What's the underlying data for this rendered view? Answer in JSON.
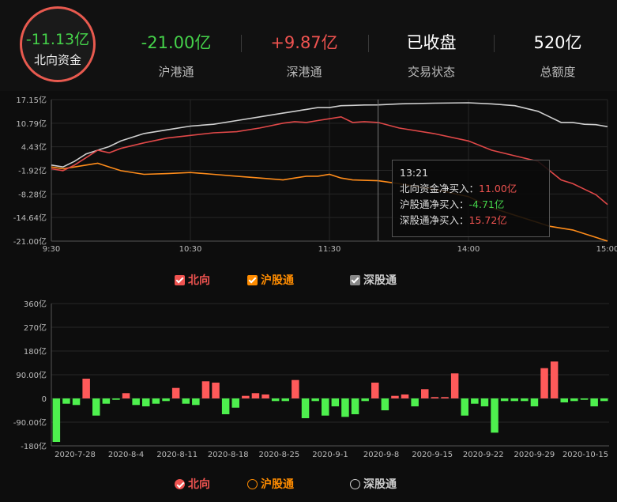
{
  "header": {
    "northbound_value": "-11.13亿",
    "northbound_label": "北向资金",
    "stats": [
      {
        "value": "-21.00亿",
        "label": "沪港通",
        "color": "#45d24a"
      },
      {
        "value": "+9.87亿",
        "label": "深港通",
        "color": "#ef5350"
      },
      {
        "value": "已收盘",
        "label": "交易状态",
        "color": "#ffffff"
      },
      {
        "value": "520亿",
        "label": "总额度",
        "color": "#ffffff"
      }
    ]
  },
  "intraday": {
    "tooltip": {
      "time": "13:21",
      "rows": [
        {
          "label": "北向资金净买入：",
          "value": "11.00亿",
          "color": "#ef5350"
        },
        {
          "label": "沪股通净买入：",
          "value": "-4.71亿",
          "color": "#45d24a"
        },
        {
          "label": "深股通净买入：",
          "value": "15.72亿",
          "color": "#ef5350"
        }
      ]
    },
    "legend": [
      {
        "label": "北向",
        "color": "#ef5350"
      },
      {
        "label": "沪股通",
        "color": "#ff8c00"
      },
      {
        "label": "深股通",
        "color": "#999999"
      }
    ]
  },
  "daily": {
    "legend": [
      {
        "label": "北向",
        "color": "#ef5350"
      },
      {
        "label": "沪股通",
        "color": "#ff8c00"
      },
      {
        "label": "深股通",
        "color": "#cccccc"
      }
    ]
  },
  "colors": {
    "up": "#ff5a5a",
    "down": "#4ef04e",
    "northbound_line": "#e04848",
    "sh_line": "#ff8c1a",
    "sz_line": "#cfcfcf"
  },
  "chart_data": [
    {
      "type": "line",
      "ylim": [
        -21.0,
        17.15
      ],
      "y_ticks": [
        "17.15亿",
        "10.79亿",
        "4.43亿",
        "-1.92亿",
        "-8.28亿",
        "-14.64亿",
        "-21.00亿"
      ],
      "x_ticks": [
        "9:30",
        "10:30",
        "11:30",
        "14:00",
        "15:00"
      ],
      "grid": true,
      "x": [
        "9:30",
        "9:35",
        "9:40",
        "9:45",
        "9:50",
        "9:55",
        "10:00",
        "10:10",
        "10:20",
        "10:30",
        "10:40",
        "10:50",
        "11:00",
        "11:10",
        "11:15",
        "11:20",
        "11:25",
        "11:30",
        "13:05",
        "13:10",
        "13:15",
        "13:21",
        "13:30",
        "13:45",
        "14:00",
        "14:10",
        "14:20",
        "14:30",
        "14:35",
        "14:40",
        "14:45",
        "14:50",
        "14:55",
        "15:00"
      ],
      "series": [
        {
          "name": "北向",
          "values": [
            -1.5,
            -2.0,
            -0.5,
            1.5,
            3.5,
            2.8,
            4.0,
            5.5,
            6.8,
            7.5,
            8.2,
            8.5,
            9.5,
            10.8,
            11.2,
            11.0,
            11.5,
            12.0,
            12.5,
            11.0,
            11.2,
            11.0,
            9.5,
            8.0,
            6.0,
            3.5,
            2.0,
            0.5,
            -2.0,
            -4.5,
            -5.5,
            -7.0,
            -8.5,
            -11.13
          ]
        },
        {
          "name": "沪股通",
          "values": [
            -1.0,
            -1.5,
            -1.0,
            -0.5,
            0.0,
            -1.0,
            -2.0,
            -3.0,
            -2.8,
            -2.5,
            -3.0,
            -3.5,
            -4.0,
            -4.5,
            -4.0,
            -3.5,
            -3.5,
            -3.0,
            -4.0,
            -4.5,
            -4.6,
            -4.71,
            -5.5,
            -7.0,
            -9.0,
            -12.0,
            -14.0,
            -16.0,
            -17.0,
            -17.5,
            -18.0,
            -19.0,
            -20.0,
            -21.0
          ]
        },
        {
          "name": "深股通",
          "values": [
            -0.5,
            -1.0,
            0.5,
            2.5,
            3.5,
            4.5,
            6.0,
            8.0,
            9.0,
            10.0,
            10.5,
            11.5,
            12.5,
            13.5,
            14.0,
            14.5,
            15.0,
            15.0,
            15.5,
            15.6,
            15.7,
            15.72,
            16.0,
            16.2,
            16.3,
            16.0,
            15.5,
            14.0,
            12.5,
            11.0,
            11.0,
            10.5,
            10.4,
            9.87
          ]
        }
      ]
    },
    {
      "type": "bar",
      "ylim": [
        -180,
        360
      ],
      "y_ticks": [
        "360亿",
        "270亿",
        "180亿",
        "90.00亿",
        "0",
        "-90.00亿",
        "-180亿"
      ],
      "x_ticks": [
        "2020-7-28",
        "2020-8-4",
        "2020-8-11",
        "2020-8-18",
        "2020-8-25",
        "2020-9-1",
        "2020-9-8",
        "2020-9-15",
        "2020-9-22",
        "2020-9-29",
        "2020-10-15"
      ],
      "series": [
        {
          "name": "北向",
          "values": [
            -165,
            -20,
            -25,
            75,
            -65,
            -20,
            -5,
            20,
            -25,
            -30,
            -20,
            -10,
            40,
            -20,
            -25,
            65,
            60,
            -60,
            -35,
            10,
            20,
            15,
            -10,
            -10,
            70,
            -75,
            -10,
            -65,
            -30,
            -70,
            -60,
            -10,
            60,
            -45,
            10,
            15,
            -30,
            35,
            5,
            5,
            95,
            -65,
            -20,
            -30,
            -130,
            -10,
            -10,
            -10,
            -30,
            115,
            140,
            -15,
            -10,
            -5,
            -30,
            -10
          ]
        }
      ]
    }
  ]
}
